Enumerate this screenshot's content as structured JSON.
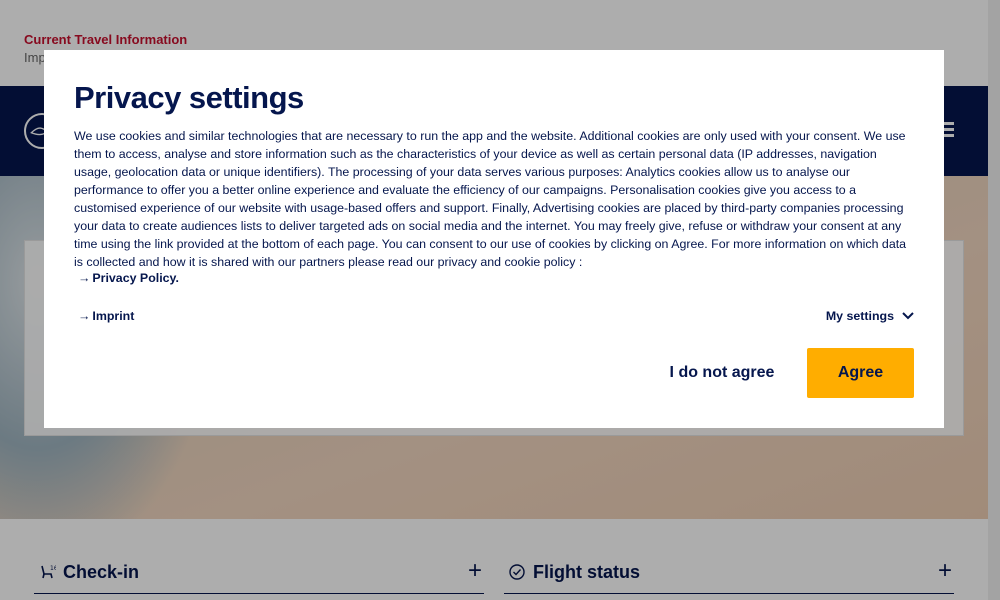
{
  "topbar": {
    "travel_info": "Current Travel Information",
    "imprint_partial": "Imp"
  },
  "navbar": {
    "logo_icon": "crane-logo-icon",
    "menu_icon": "hamburger-menu-icon"
  },
  "lower": {
    "checkin_label": "Check-in",
    "checkin_icon": "seat-icon",
    "flight_status_label": "Flight status",
    "flight_status_icon": "check-circle-icon",
    "expand_icon": "plus-icon"
  },
  "modal": {
    "title": "Privacy settings",
    "body": "We use cookies and similar technologies that are necessary to run the app and the website. Additional cookies are only used with your consent. We use them to access, analyse and store information such as the characteristics of your device as well as certain personal data (IP addresses, navigation usage, geolocation data or unique identifiers). The processing of your data serves various purposes: Analytics cookies allow us to analyse our performance to offer you a better online experience and evaluate the efficiency of our campaigns. Personalisation cookies give you access to a customised experience of our website with usage-based offers and support. Finally, Advertising cookies are placed by third-party companies processing your data to create audiences lists to deliver targeted ads on social media and the internet. You may freely give, refuse or withdraw your consent at any time using the link provided at the bottom of each page. You can consent to our use of cookies by clicking on Agree. For more information on which data is collected and how it is shared with our partners please read our privacy and cookie policy :",
    "privacy_link": "Privacy Policy.",
    "imprint_link": "Imprint",
    "settings_label": "My settings",
    "disagree_label": "I do not agree",
    "agree_label": "Agree",
    "arrow_glyph": "→"
  },
  "colors": {
    "brand_navy": "#05164d",
    "agree_yellow": "#ffad00",
    "travel_red": "#c8102e"
  }
}
